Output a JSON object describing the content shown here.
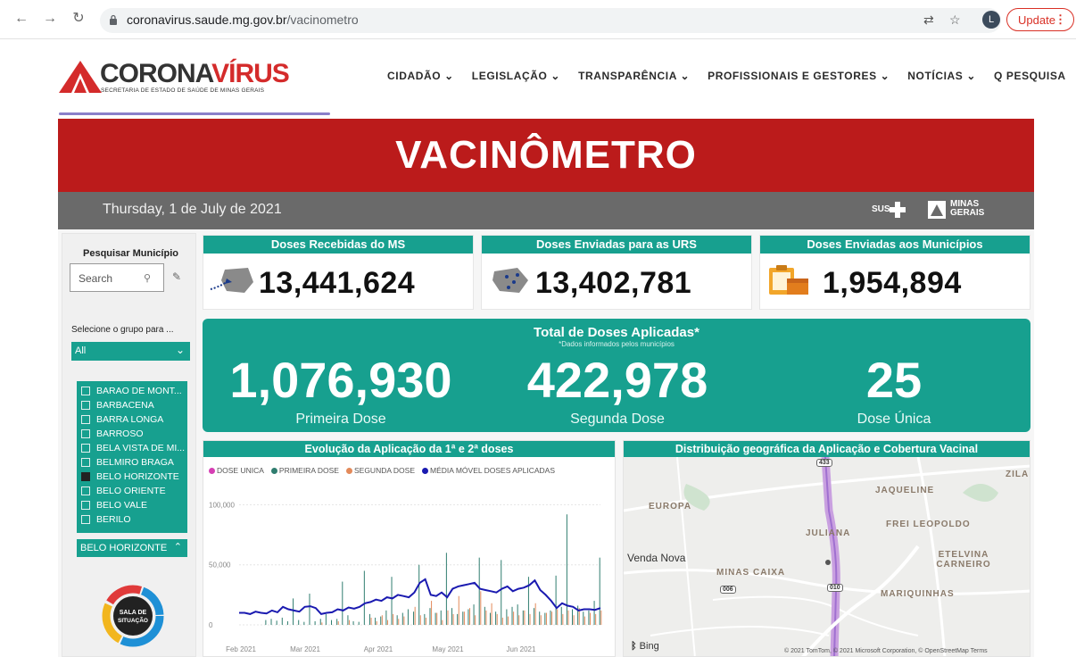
{
  "browser": {
    "url_host": "coronavirus.saude.mg.gov.br",
    "url_path": "/vacinometro",
    "avatar_letter": "L",
    "update_label": "Update"
  },
  "site": {
    "logo_main": "CORONA",
    "logo_accent": "VÍRUS",
    "logo_sub": "SECRETARIA DE ESTADO DE SAÚDE DE MINAS GERAIS",
    "menu": [
      "CIDADÃO ⌄",
      "LEGISLAÇÃO ⌄",
      "TRANSPARÊNCIA ⌄",
      "PROFISSIONAIS E GESTORES ⌄",
      "NOTÍCIAS ⌄",
      "Q PESQUISA"
    ]
  },
  "banner": {
    "title": "VACINÔMETRO"
  },
  "datebar": {
    "date": "Thursday, 1 de July de 2021",
    "sus": "SUS",
    "mg_text": "MINAS GERAIS"
  },
  "sidebar": {
    "title": "Pesquisar Município",
    "search_placeholder": "Search",
    "group_label": "Selecione o grupo para ...",
    "group_value": "All",
    "municipalities": [
      {
        "name": "BARAO DE MONT...",
        "checked": false
      },
      {
        "name": "BARBACENA",
        "checked": false
      },
      {
        "name": "BARRA LONGA",
        "checked": false
      },
      {
        "name": "BARROSO",
        "checked": false
      },
      {
        "name": "BELA VISTA DE MI...",
        "checked": false
      },
      {
        "name": "BELMIRO BRAGA",
        "checked": false
      },
      {
        "name": "BELO HORIZONTE",
        "checked": true
      },
      {
        "name": "BELO ORIENTE",
        "checked": false
      },
      {
        "name": "BELO VALE",
        "checked": false
      },
      {
        "name": "BERILO",
        "checked": false
      }
    ],
    "selected_municipality": "BELO HORIZONTE",
    "sala_text": "SALA DE SITUAÇÃO"
  },
  "kpis": [
    {
      "title": "Doses Recebidas do MS",
      "value": "13,441,624"
    },
    {
      "title": "Doses Enviadas para as URS",
      "value": "13,402,781"
    },
    {
      "title": "Doses Enviadas aos Municípios",
      "value": "1,954,894"
    }
  ],
  "total": {
    "title": "Total de Doses Aplicadas*",
    "subtitle": "*Dados informados pelos municípios",
    "first_value": "1,076,930",
    "first_label": "Primeira Dose",
    "second_value": "422,978",
    "second_label": "Segunda Dose",
    "single_value": "25",
    "single_label": "Dose Única"
  },
  "chart_panel": {
    "title": "Evolução da Aplicação da 1ª e 2ª doses",
    "legend": [
      {
        "label": "DOSE UNICA",
        "color": "#d63fb4"
      },
      {
        "label": "PRIMEIRA DOSE",
        "color": "#2f7d6f"
      },
      {
        "label": "SEGUNDA DOSE",
        "color": "#e38a5a"
      },
      {
        "label": "MÉDIA MÓVEL DOSES APLICADAS",
        "color": "#1a1ab0"
      }
    ]
  },
  "chart_data": {
    "type": "bar",
    "x_ticks": [
      "Feb 2021",
      "Mar 2021",
      "Apr 2021",
      "May 2021",
      "Jun 2021"
    ],
    "y_ticks": [
      "0",
      "50,000",
      "100,000"
    ],
    "ylim": [
      0,
      110000
    ],
    "series": [
      {
        "name": "PRIMEIRA DOSE",
        "values": [
          0,
          0,
          0,
          0,
          0,
          4000,
          5000,
          3500,
          6000,
          3000,
          22000,
          4000,
          2500,
          26000,
          3000,
          5000,
          9000,
          4000,
          5000,
          36000,
          8000,
          3000,
          2500,
          45000,
          9000,
          6000,
          7000,
          12000,
          40000,
          8000,
          10000,
          13000,
          11000,
          50000,
          9000,
          14000,
          10000,
          12000,
          60000,
          14000,
          9000,
          11000,
          13000,
          17000,
          56000,
          15000,
          10000,
          11000,
          54000,
          13000,
          15000,
          17000,
          12000,
          40000,
          14000,
          11000,
          10000,
          12000,
          41000,
          15000,
          92000,
          13000,
          16000,
          11000,
          12000,
          20000,
          56000
        ]
      },
      {
        "name": "SEGUNDA DOSE",
        "values": [
          0,
          0,
          0,
          0,
          0,
          0,
          0,
          0,
          0,
          0,
          0,
          0,
          0,
          0,
          0,
          2000,
          0,
          0,
          3000,
          0,
          4000,
          0,
          0,
          0,
          6000,
          3000,
          8000,
          4000,
          9000,
          5000,
          7000,
          0,
          15000,
          8000,
          6000,
          20000,
          10000,
          4000,
          12000,
          9000,
          24000,
          11000,
          14000,
          8000,
          28000,
          12000,
          18000,
          9000,
          6000,
          7000,
          11000,
          8000,
          12000,
          9000,
          18000,
          8000,
          10000,
          11000,
          13000,
          9000,
          12000,
          8000,
          14000,
          7000,
          10000,
          9000,
          12000
        ]
      },
      {
        "name": "MÉDIA MÓVEL DOSES APLICADAS",
        "values": [
          10000,
          10000,
          9000,
          11000,
          10000,
          9500,
          12000,
          10500,
          15000,
          13000,
          12000,
          11000,
          15000,
          15500,
          14000,
          9000,
          10000,
          10500,
          13000,
          12000,
          14500,
          13500,
          15000,
          18000,
          19000,
          21000,
          20000,
          23000,
          22000,
          25000,
          24000,
          23000,
          27000,
          35000,
          38000,
          25000,
          24000,
          27000,
          23000,
          30000,
          32000,
          33000,
          34000,
          35000,
          30000,
          29000,
          28000,
          27000,
          30000,
          32000,
          28000,
          30000,
          31000,
          33000,
          37000,
          29000,
          25000,
          20000,
          14000,
          18000,
          16000,
          15000,
          12000,
          13000,
          13000,
          12500,
          14000
        ]
      }
    ]
  },
  "map_panel": {
    "title": "Distribuição geográfica da Aplicação e Cobertura Vacinal",
    "labels": [
      "EUROPA",
      "JAQUELINE",
      "FREI LEOPOLDO",
      "JULIANA",
      "ZILA",
      "Venda Nova",
      "MINAS CAIXA",
      "ETELVINA CARNEIRO",
      "MARIQUINHAS"
    ],
    "road_badges": [
      "433",
      "006",
      "010"
    ],
    "bing": "Bing",
    "copyright": "© 2021 TomTom, © 2021 Microsoft Corporation, © OpenStreetMap  Terms"
  }
}
